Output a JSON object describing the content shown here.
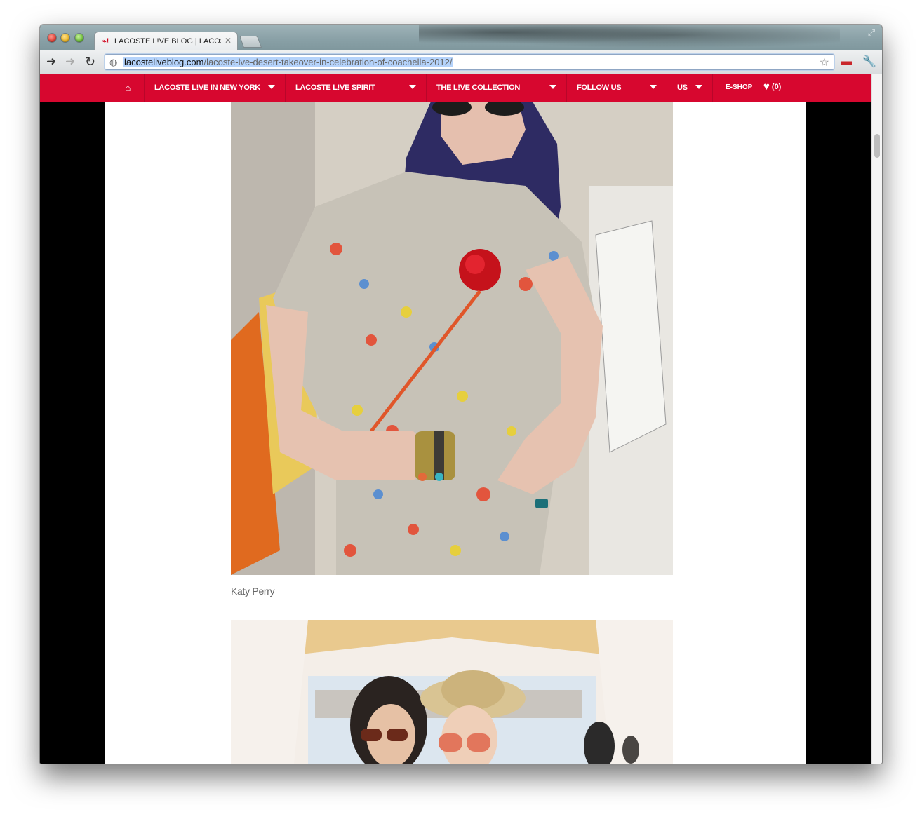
{
  "browser": {
    "tab_title": "LACOSTE L!VE BLOG | LACOS",
    "tab_favicon": "red-crocodile-icon",
    "url_host": "lacosteliveblog.com",
    "url_path": "/lacoste-lve-desert-takeover-in-celebration-of-coachella-2012/"
  },
  "menu": {
    "home_icon": "home-icon",
    "items": [
      {
        "label": "LACOSTE L!VE IN NEW YORK"
      },
      {
        "label": "LACOSTE L!VE SPIRIT"
      },
      {
        "label": "THE L!VE COLLECTION"
      },
      {
        "label": "FOLLOW US"
      },
      {
        "label": "US"
      }
    ],
    "eshop_label": "E-SHOP",
    "wishlist_count": "(0)"
  },
  "post": {
    "caption_1": "Katy Perry"
  },
  "colors": {
    "brand_red": "#d7072f",
    "page_bg": "#000000"
  }
}
